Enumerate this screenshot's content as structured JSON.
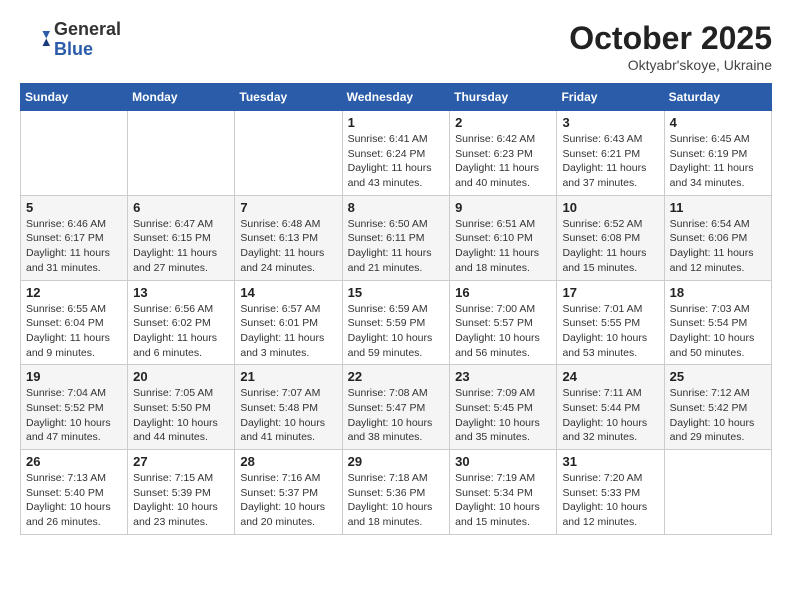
{
  "header": {
    "logo_general": "General",
    "logo_blue": "Blue",
    "month_year": "October 2025",
    "location": "Oktyabr'skoye, Ukraine"
  },
  "weekdays": [
    "Sunday",
    "Monday",
    "Tuesday",
    "Wednesday",
    "Thursday",
    "Friday",
    "Saturday"
  ],
  "weeks": [
    [
      {
        "day": "",
        "info": ""
      },
      {
        "day": "",
        "info": ""
      },
      {
        "day": "",
        "info": ""
      },
      {
        "day": "1",
        "info": "Sunrise: 6:41 AM\nSunset: 6:24 PM\nDaylight: 11 hours\nand 43 minutes."
      },
      {
        "day": "2",
        "info": "Sunrise: 6:42 AM\nSunset: 6:23 PM\nDaylight: 11 hours\nand 40 minutes."
      },
      {
        "day": "3",
        "info": "Sunrise: 6:43 AM\nSunset: 6:21 PM\nDaylight: 11 hours\nand 37 minutes."
      },
      {
        "day": "4",
        "info": "Sunrise: 6:45 AM\nSunset: 6:19 PM\nDaylight: 11 hours\nand 34 minutes."
      }
    ],
    [
      {
        "day": "5",
        "info": "Sunrise: 6:46 AM\nSunset: 6:17 PM\nDaylight: 11 hours\nand 31 minutes."
      },
      {
        "day": "6",
        "info": "Sunrise: 6:47 AM\nSunset: 6:15 PM\nDaylight: 11 hours\nand 27 minutes."
      },
      {
        "day": "7",
        "info": "Sunrise: 6:48 AM\nSunset: 6:13 PM\nDaylight: 11 hours\nand 24 minutes."
      },
      {
        "day": "8",
        "info": "Sunrise: 6:50 AM\nSunset: 6:11 PM\nDaylight: 11 hours\nand 21 minutes."
      },
      {
        "day": "9",
        "info": "Sunrise: 6:51 AM\nSunset: 6:10 PM\nDaylight: 11 hours\nand 18 minutes."
      },
      {
        "day": "10",
        "info": "Sunrise: 6:52 AM\nSunset: 6:08 PM\nDaylight: 11 hours\nand 15 minutes."
      },
      {
        "day": "11",
        "info": "Sunrise: 6:54 AM\nSunset: 6:06 PM\nDaylight: 11 hours\nand 12 minutes."
      }
    ],
    [
      {
        "day": "12",
        "info": "Sunrise: 6:55 AM\nSunset: 6:04 PM\nDaylight: 11 hours\nand 9 minutes."
      },
      {
        "day": "13",
        "info": "Sunrise: 6:56 AM\nSunset: 6:02 PM\nDaylight: 11 hours\nand 6 minutes."
      },
      {
        "day": "14",
        "info": "Sunrise: 6:57 AM\nSunset: 6:01 PM\nDaylight: 11 hours\nand 3 minutes."
      },
      {
        "day": "15",
        "info": "Sunrise: 6:59 AM\nSunset: 5:59 PM\nDaylight: 10 hours\nand 59 minutes."
      },
      {
        "day": "16",
        "info": "Sunrise: 7:00 AM\nSunset: 5:57 PM\nDaylight: 10 hours\nand 56 minutes."
      },
      {
        "day": "17",
        "info": "Sunrise: 7:01 AM\nSunset: 5:55 PM\nDaylight: 10 hours\nand 53 minutes."
      },
      {
        "day": "18",
        "info": "Sunrise: 7:03 AM\nSunset: 5:54 PM\nDaylight: 10 hours\nand 50 minutes."
      }
    ],
    [
      {
        "day": "19",
        "info": "Sunrise: 7:04 AM\nSunset: 5:52 PM\nDaylight: 10 hours\nand 47 minutes."
      },
      {
        "day": "20",
        "info": "Sunrise: 7:05 AM\nSunset: 5:50 PM\nDaylight: 10 hours\nand 44 minutes."
      },
      {
        "day": "21",
        "info": "Sunrise: 7:07 AM\nSunset: 5:48 PM\nDaylight: 10 hours\nand 41 minutes."
      },
      {
        "day": "22",
        "info": "Sunrise: 7:08 AM\nSunset: 5:47 PM\nDaylight: 10 hours\nand 38 minutes."
      },
      {
        "day": "23",
        "info": "Sunrise: 7:09 AM\nSunset: 5:45 PM\nDaylight: 10 hours\nand 35 minutes."
      },
      {
        "day": "24",
        "info": "Sunrise: 7:11 AM\nSunset: 5:44 PM\nDaylight: 10 hours\nand 32 minutes."
      },
      {
        "day": "25",
        "info": "Sunrise: 7:12 AM\nSunset: 5:42 PM\nDaylight: 10 hours\nand 29 minutes."
      }
    ],
    [
      {
        "day": "26",
        "info": "Sunrise: 7:13 AM\nSunset: 5:40 PM\nDaylight: 10 hours\nand 26 minutes."
      },
      {
        "day": "27",
        "info": "Sunrise: 7:15 AM\nSunset: 5:39 PM\nDaylight: 10 hours\nand 23 minutes."
      },
      {
        "day": "28",
        "info": "Sunrise: 7:16 AM\nSunset: 5:37 PM\nDaylight: 10 hours\nand 20 minutes."
      },
      {
        "day": "29",
        "info": "Sunrise: 7:18 AM\nSunset: 5:36 PM\nDaylight: 10 hours\nand 18 minutes."
      },
      {
        "day": "30",
        "info": "Sunrise: 7:19 AM\nSunset: 5:34 PM\nDaylight: 10 hours\nand 15 minutes."
      },
      {
        "day": "31",
        "info": "Sunrise: 7:20 AM\nSunset: 5:33 PM\nDaylight: 10 hours\nand 12 minutes."
      },
      {
        "day": "",
        "info": ""
      }
    ]
  ]
}
